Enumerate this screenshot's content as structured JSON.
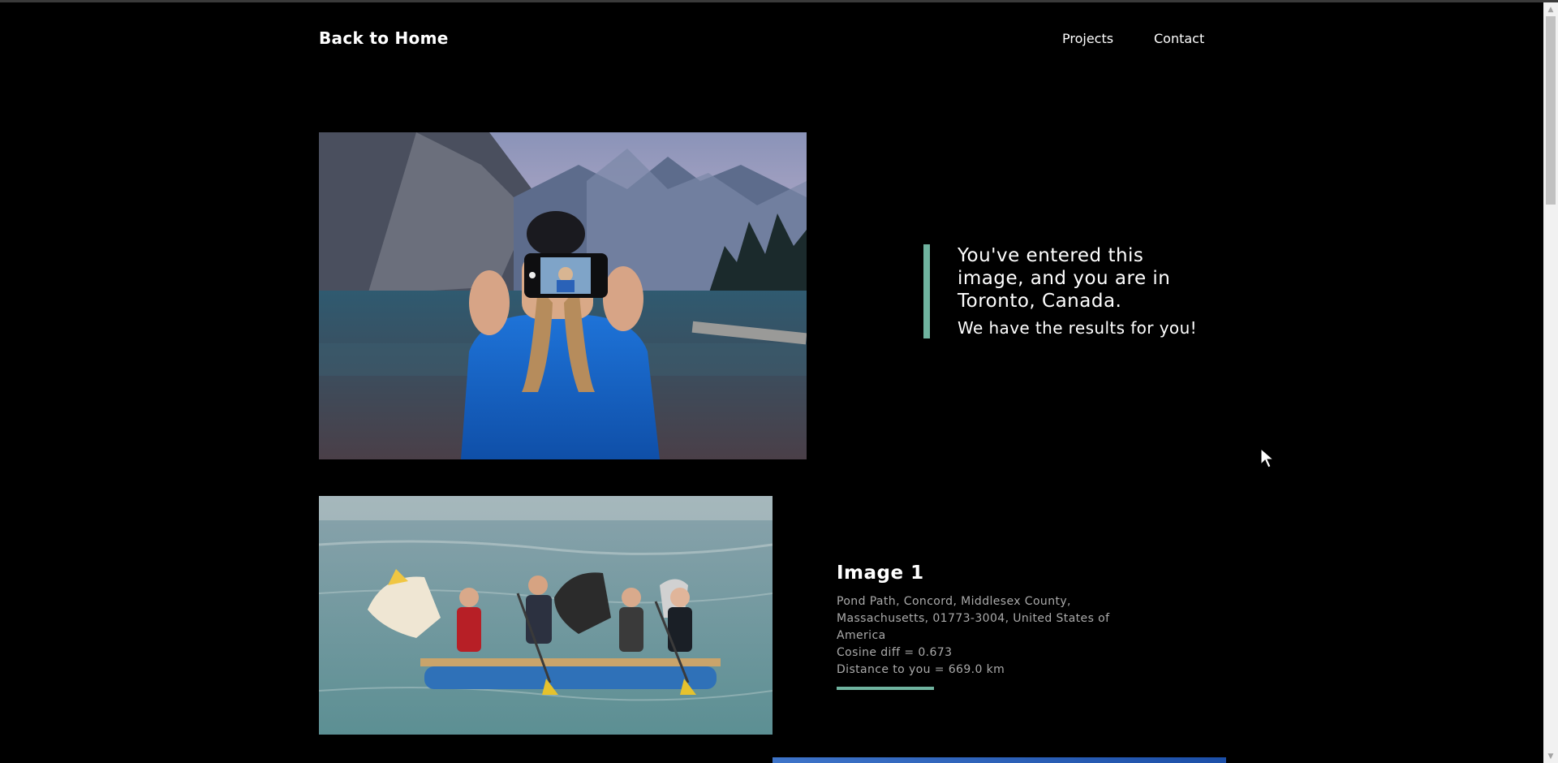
{
  "header": {
    "brand": "Back to Home",
    "nav": [
      "Projects",
      "Contact"
    ]
  },
  "hero": {
    "image_alt": "Person holding a phone taking a selfie in front of a mountain lake",
    "line1": "You've entered this image, and you are in Toronto, Canada.",
    "line2": "We have the results for you!"
  },
  "results": [
    {
      "title": "Image 1",
      "image_alt": "Children paddling a raft decorated with horse heads on a lake",
      "address": "Pond Path, Concord, Middlesex County, Massachusetts, 01773-3004, United States of America",
      "cosine": "Cosine diff = 0.673",
      "distance": "Distance to you = 669.0 km"
    }
  ],
  "colors": {
    "background": "#000000",
    "accent": "#6fb39f",
    "meta_text": "#aaaaaa"
  }
}
